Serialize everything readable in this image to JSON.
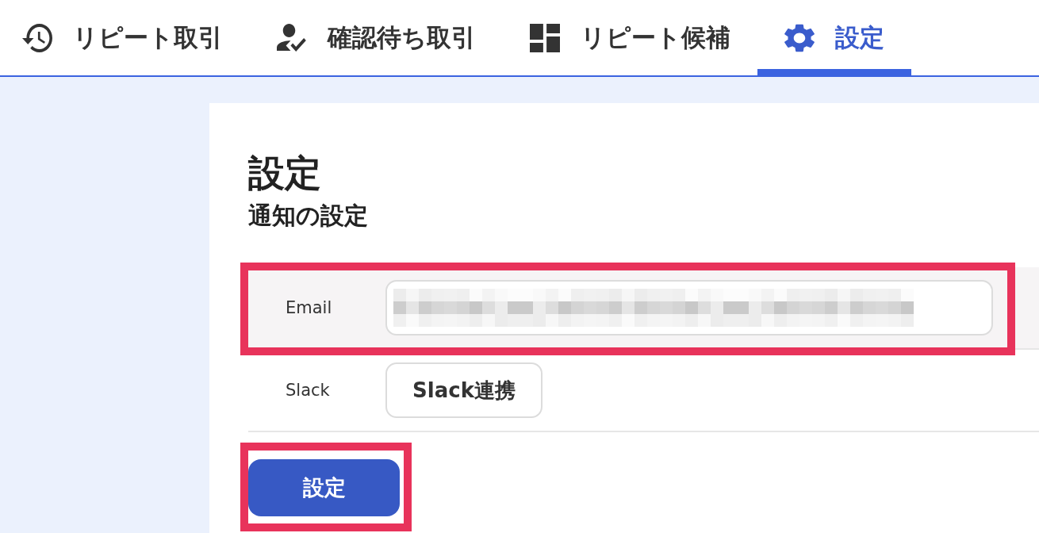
{
  "tabs": [
    {
      "label": "リピート取引",
      "selected": false
    },
    {
      "label": "確認待ち取引",
      "selected": false
    },
    {
      "label": "リピート候補",
      "selected": false
    },
    {
      "label": "設定",
      "selected": true
    }
  ],
  "page": {
    "title": "設定",
    "section_title": "通知の設定"
  },
  "notification_rows": [
    {
      "kind": "input",
      "label": "Email",
      "value_blurred": true,
      "hovered": true,
      "highlighted": true
    },
    {
      "kind": "button",
      "label": "Slack",
      "button_label": "Slack連携",
      "hovered": false,
      "highlighted": false
    }
  ],
  "submit_button": {
    "label": "設定",
    "highlighted": true
  }
}
